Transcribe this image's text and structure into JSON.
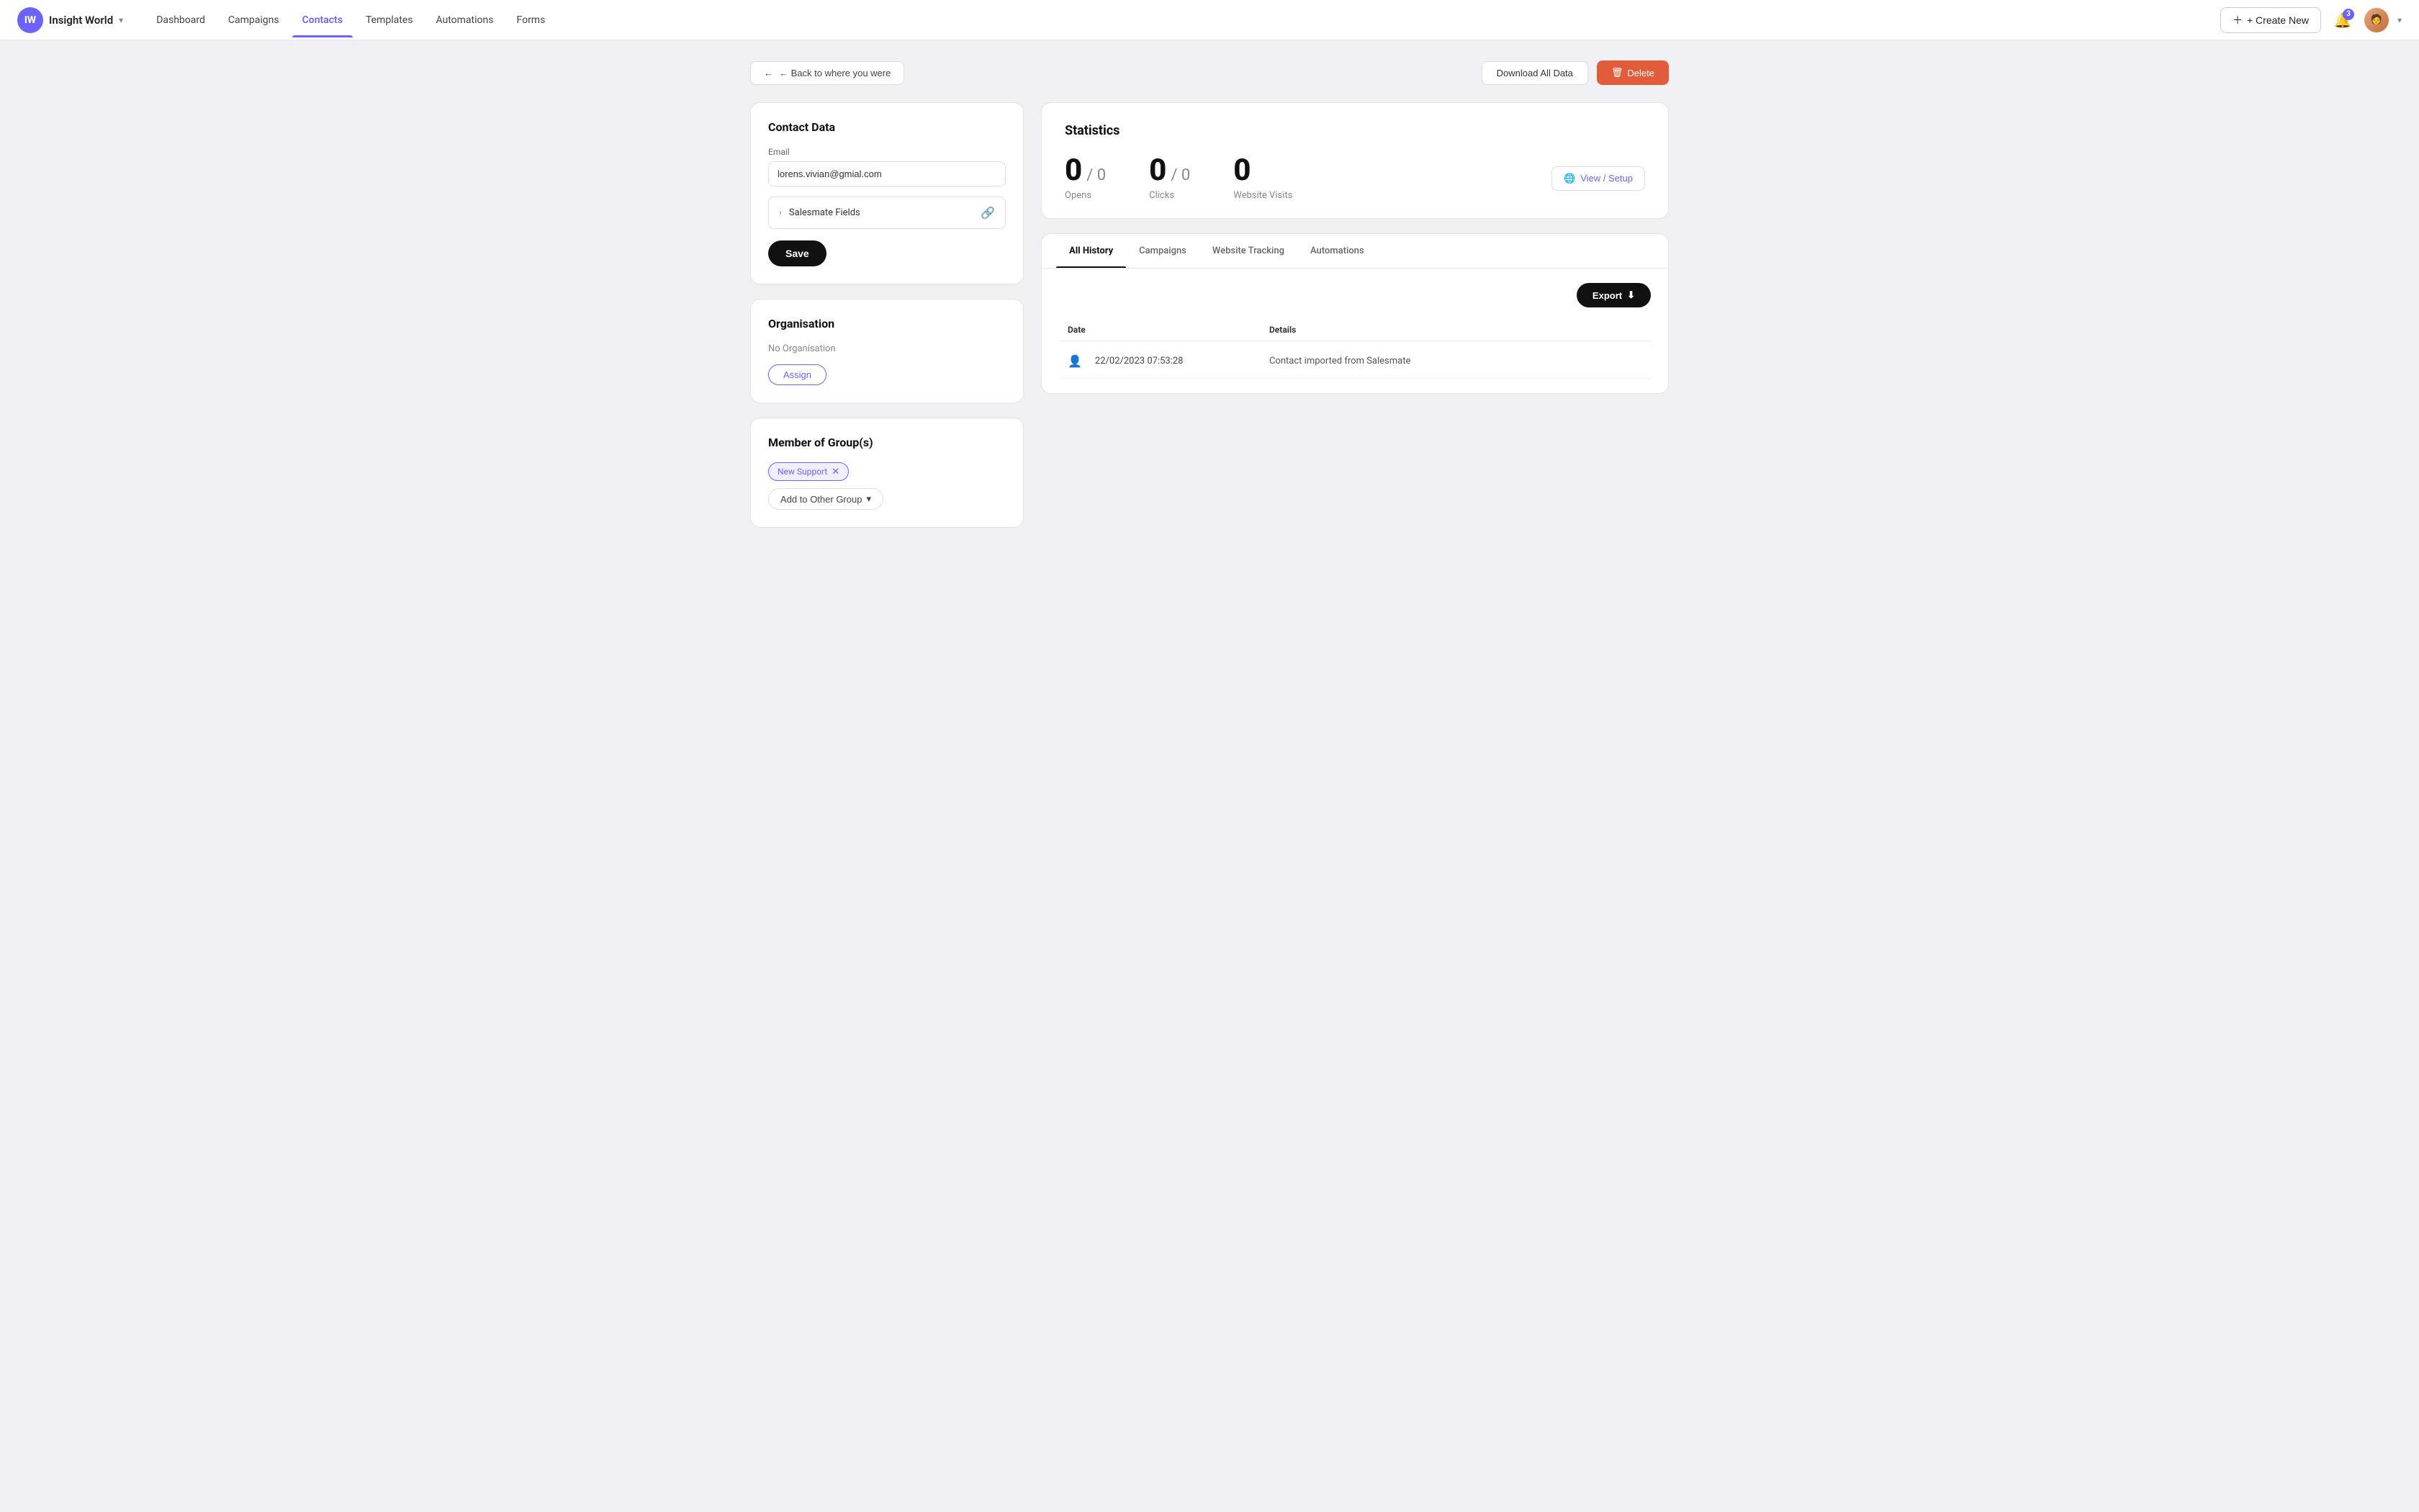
{
  "brand": {
    "name": "Insight World",
    "chevron": "▾"
  },
  "nav": {
    "links": [
      {
        "id": "dashboard",
        "label": "Dashboard",
        "active": false
      },
      {
        "id": "campaigns",
        "label": "Campaigns",
        "active": false
      },
      {
        "id": "contacts",
        "label": "Contacts",
        "active": true
      },
      {
        "id": "templates",
        "label": "Templates",
        "active": false
      },
      {
        "id": "automations",
        "label": "Automations",
        "active": false
      },
      {
        "id": "forms",
        "label": "Forms",
        "active": false
      }
    ],
    "create_new_label": "+ Create New",
    "notification_count": "3"
  },
  "topbar": {
    "back_label": "← Back to where you were",
    "download_label": "Download All Data",
    "delete_label": "Delete"
  },
  "contact_data": {
    "card_title": "Contact Data",
    "email_label": "Email",
    "email_value": "lorens.vivian@gmial.com",
    "salesmate_fields_label": "Salesmate Fields",
    "save_label": "Save"
  },
  "organisation": {
    "card_title": "Organisation",
    "no_org_label": "No Organisation",
    "assign_label": "Assign"
  },
  "member_groups": {
    "card_title": "Member of Group(s)",
    "tags": [
      {
        "id": "new-support",
        "label": "New Support"
      }
    ],
    "add_group_label": "Add to Other Group",
    "add_group_chevron": "▾"
  },
  "statistics": {
    "title": "Statistics",
    "opens": {
      "value": "0",
      "slash": "/ 0",
      "label": "Opens"
    },
    "clicks": {
      "value": "0",
      "slash": "/ 0",
      "label": "Clicks"
    },
    "website_visits": {
      "value": "0",
      "label": "Website Visits"
    },
    "view_setup_label": "View / Setup"
  },
  "tabs": [
    {
      "id": "all-history",
      "label": "All History",
      "active": true
    },
    {
      "id": "campaigns",
      "label": "Campaigns",
      "active": false
    },
    {
      "id": "website-tracking",
      "label": "Website Tracking",
      "active": false
    },
    {
      "id": "automations",
      "label": "Automations",
      "active": false
    }
  ],
  "history": {
    "export_label": "Export",
    "columns": {
      "date": "Date",
      "details": "Details"
    },
    "rows": [
      {
        "date": "22/02/2023 07:53:28",
        "details": "Contact imported from Salesmate"
      }
    ]
  }
}
